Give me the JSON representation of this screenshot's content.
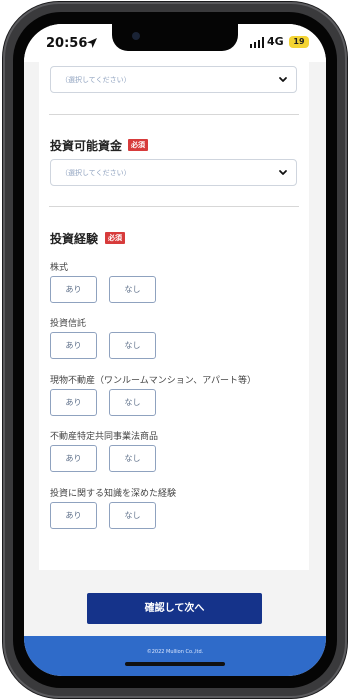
{
  "status_bar": {
    "time": "20:56",
    "network": "4G",
    "battery": "19"
  },
  "form": {
    "select_placeholder": "（選択してください）",
    "investable_funds": {
      "label": "投資可能資金",
      "required_badge": "必須"
    },
    "experience": {
      "label": "投資経験",
      "required_badge": "必須",
      "questions": [
        {
          "label": "株式",
          "yes": "あり",
          "no": "なし"
        },
        {
          "label": "投資信託",
          "yes": "あり",
          "no": "なし"
        },
        {
          "label": "現物不動産（ワンルームマンション、アパート等）",
          "yes": "あり",
          "no": "なし"
        },
        {
          "label": "不動産特定共同事業法商品",
          "yes": "あり",
          "no": "なし"
        },
        {
          "label": "投資に関する知識を深めた経験",
          "yes": "あり",
          "no": "なし"
        }
      ]
    },
    "confirm_button": "確認して次へ"
  },
  "footer": {
    "copyright": "©2022 Mullion Co.,ltd."
  },
  "icons": {
    "location": "location-arrow-icon",
    "signal": "signal-icon",
    "chevron": "chevron-down-icon"
  }
}
